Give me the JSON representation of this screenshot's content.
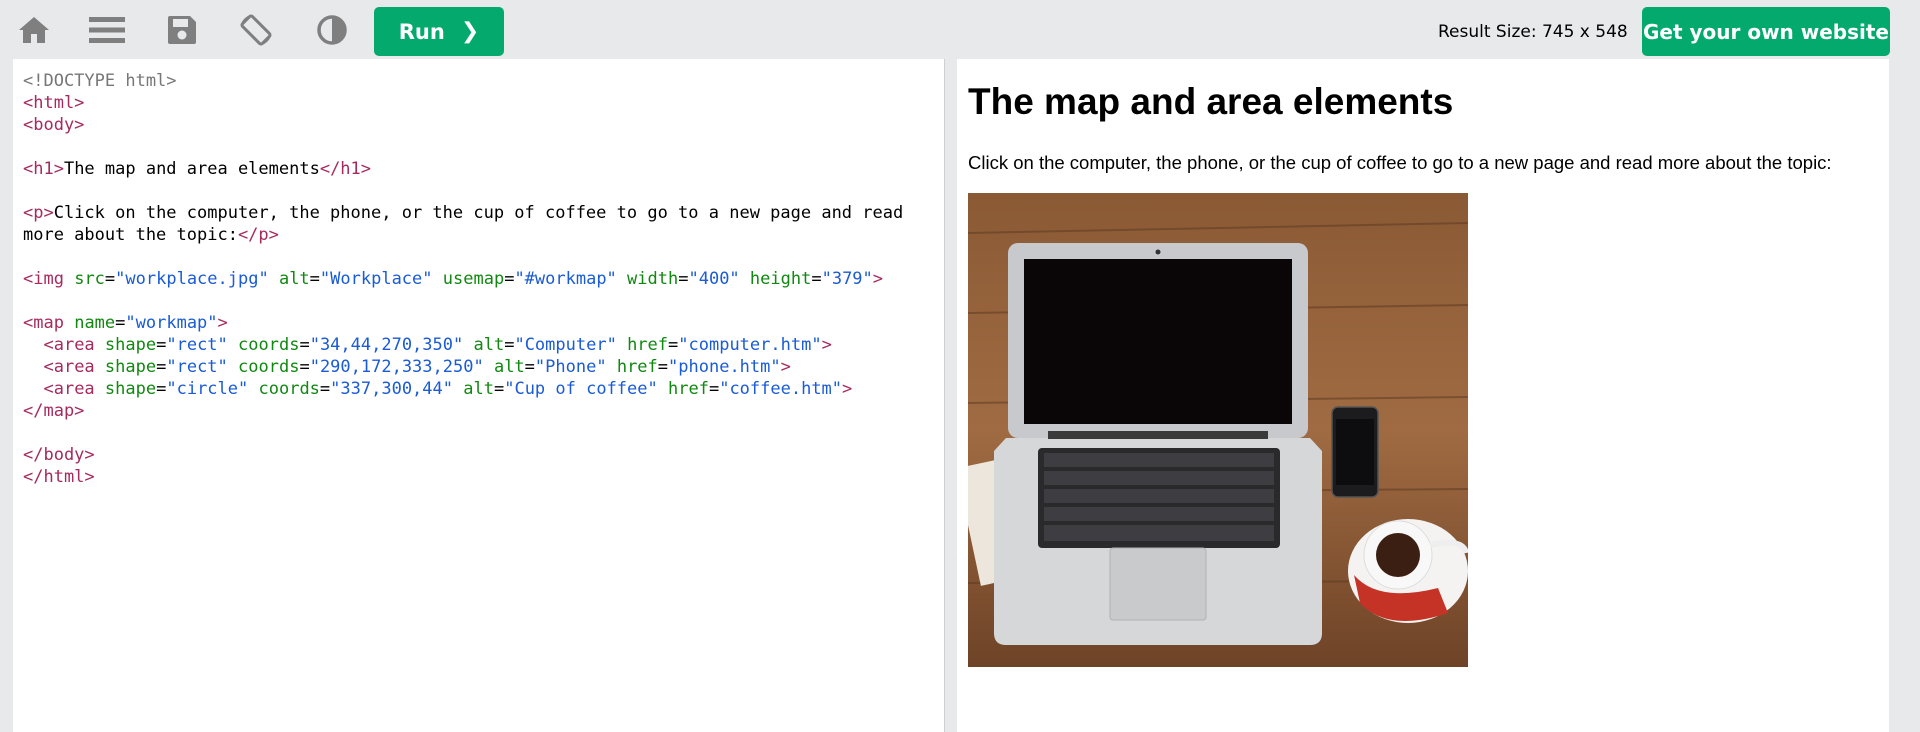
{
  "toolbar": {
    "icons": [
      "home-icon",
      "menu-icon",
      "save-icon",
      "rotate-icon",
      "contrast-icon"
    ],
    "run_label": "Run",
    "run_chevron": "❯",
    "result_size": "Result Size: 745 x 548",
    "own_website_label": "Get your own website"
  },
  "editor": {
    "lines": [
      [
        {
          "c": "p",
          "t": "<!DOCTYPE html>"
        }
      ],
      [
        {
          "c": "t",
          "t": "<html>"
        }
      ],
      [
        {
          "c": "t",
          "t": "<body>"
        }
      ],
      [],
      [
        {
          "c": "t",
          "t": "<h1>"
        },
        {
          "c": "x",
          "t": "The map and area elements"
        },
        {
          "c": "t",
          "t": "</h1>"
        }
      ],
      [],
      [
        {
          "c": "t",
          "t": "<p>"
        },
        {
          "c": "x",
          "t": "Click on the computer, the phone, or the cup of coffee to go to a new page and read"
        }
      ],
      [
        {
          "c": "x",
          "t": "more about the topic:"
        },
        {
          "c": "t",
          "t": "</p>"
        }
      ],
      [],
      [
        {
          "c": "t",
          "t": "<img"
        },
        {
          "c": "x",
          "t": " "
        },
        {
          "c": "a",
          "t": "src"
        },
        {
          "c": "x",
          "t": "="
        },
        {
          "c": "v",
          "t": "\"workplace.jpg\""
        },
        {
          "c": "x",
          "t": " "
        },
        {
          "c": "a",
          "t": "alt"
        },
        {
          "c": "x",
          "t": "="
        },
        {
          "c": "v",
          "t": "\"Workplace\""
        },
        {
          "c": "x",
          "t": " "
        },
        {
          "c": "a",
          "t": "usemap"
        },
        {
          "c": "x",
          "t": "="
        },
        {
          "c": "v",
          "t": "\"#workmap\""
        },
        {
          "c": "x",
          "t": " "
        },
        {
          "c": "a",
          "t": "width"
        },
        {
          "c": "x",
          "t": "="
        },
        {
          "c": "v",
          "t": "\"400\""
        },
        {
          "c": "x",
          "t": " "
        },
        {
          "c": "a",
          "t": "height"
        },
        {
          "c": "x",
          "t": "="
        },
        {
          "c": "v",
          "t": "\"379\""
        },
        {
          "c": "t",
          "t": ">"
        }
      ],
      [],
      [
        {
          "c": "t",
          "t": "<map"
        },
        {
          "c": "x",
          "t": " "
        },
        {
          "c": "a",
          "t": "name"
        },
        {
          "c": "x",
          "t": "="
        },
        {
          "c": "v",
          "t": "\"workmap\""
        },
        {
          "c": "t",
          "t": ">"
        }
      ],
      [
        {
          "c": "x",
          "t": "  "
        },
        {
          "c": "t",
          "t": "<area"
        },
        {
          "c": "x",
          "t": " "
        },
        {
          "c": "a",
          "t": "shape"
        },
        {
          "c": "x",
          "t": "="
        },
        {
          "c": "v",
          "t": "\"rect\""
        },
        {
          "c": "x",
          "t": " "
        },
        {
          "c": "a",
          "t": "coords"
        },
        {
          "c": "x",
          "t": "="
        },
        {
          "c": "v",
          "t": "\"34,44,270,350\""
        },
        {
          "c": "x",
          "t": " "
        },
        {
          "c": "a",
          "t": "alt"
        },
        {
          "c": "x",
          "t": "="
        },
        {
          "c": "v",
          "t": "\"Computer\""
        },
        {
          "c": "x",
          "t": " "
        },
        {
          "c": "a",
          "t": "href"
        },
        {
          "c": "x",
          "t": "="
        },
        {
          "c": "v",
          "t": "\"computer.htm\""
        },
        {
          "c": "t",
          "t": ">"
        }
      ],
      [
        {
          "c": "x",
          "t": "  "
        },
        {
          "c": "t",
          "t": "<area"
        },
        {
          "c": "x",
          "t": " "
        },
        {
          "c": "a",
          "t": "shape"
        },
        {
          "c": "x",
          "t": "="
        },
        {
          "c": "v",
          "t": "\"rect\""
        },
        {
          "c": "x",
          "t": " "
        },
        {
          "c": "a",
          "t": "coords"
        },
        {
          "c": "x",
          "t": "="
        },
        {
          "c": "v",
          "t": "\"290,172,333,250\""
        },
        {
          "c": "x",
          "t": " "
        },
        {
          "c": "a",
          "t": "alt"
        },
        {
          "c": "x",
          "t": "="
        },
        {
          "c": "v",
          "t": "\"Phone\""
        },
        {
          "c": "x",
          "t": " "
        },
        {
          "c": "a",
          "t": "href"
        },
        {
          "c": "x",
          "t": "="
        },
        {
          "c": "v",
          "t": "\"phone.htm\""
        },
        {
          "c": "t",
          "t": ">"
        }
      ],
      [
        {
          "c": "x",
          "t": "  "
        },
        {
          "c": "t",
          "t": "<area"
        },
        {
          "c": "x",
          "t": " "
        },
        {
          "c": "a",
          "t": "shape"
        },
        {
          "c": "x",
          "t": "="
        },
        {
          "c": "v",
          "t": "\"circle\""
        },
        {
          "c": "x",
          "t": " "
        },
        {
          "c": "a",
          "t": "coords"
        },
        {
          "c": "x",
          "t": "="
        },
        {
          "c": "v",
          "t": "\"337,300,44\""
        },
        {
          "c": "x",
          "t": " "
        },
        {
          "c": "a",
          "t": "alt"
        },
        {
          "c": "x",
          "t": "="
        },
        {
          "c": "v",
          "t": "\"Cup of coffee\""
        },
        {
          "c": "x",
          "t": " "
        },
        {
          "c": "a",
          "t": "href"
        },
        {
          "c": "x",
          "t": "="
        },
        {
          "c": "v",
          "t": "\"coffee.htm\""
        },
        {
          "c": "t",
          "t": ">"
        }
      ],
      [
        {
          "c": "t",
          "t": "</map>"
        }
      ],
      [],
      [
        {
          "c": "t",
          "t": "</body>"
        }
      ],
      [
        {
          "c": "t",
          "t": "</html>"
        }
      ]
    ]
  },
  "result": {
    "heading": "The map and area elements",
    "paragraph": "Click on the computer, the phone, or the cup of coffee to go to a new page and read more about the topic:",
    "image_alt": "Workplace"
  },
  "colors": {
    "accent": "#04aa6d",
    "toolbar_bg": "#e7e9eb",
    "icon": "#7f7f7f",
    "code_tag": "#a52a5e",
    "code_attr": "#118811",
    "code_value": "#1a5bd6"
  }
}
